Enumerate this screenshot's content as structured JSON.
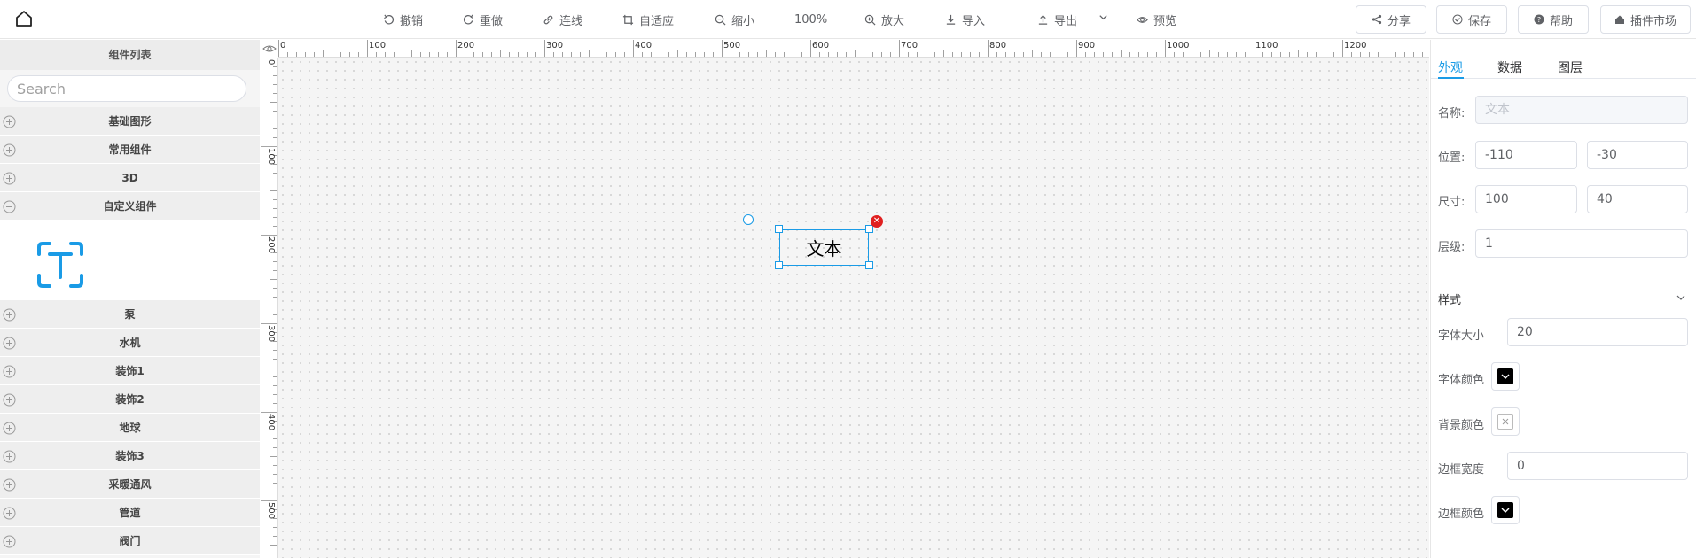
{
  "toolbar": {
    "undo": "撤销",
    "redo": "重做",
    "connect": "连线",
    "fit": "自适应",
    "zoom_out": "缩小",
    "zoom": "100%",
    "zoom_in": "放大",
    "import": "导入",
    "export": "导出",
    "preview": "预览",
    "share": "分享",
    "save": "保存",
    "help": "帮助",
    "plugin_market": "插件市场"
  },
  "left": {
    "title": "组件列表",
    "search_placeholder": "Search",
    "categories": [
      {
        "label": "基础图形",
        "expanded": false
      },
      {
        "label": "常用组件",
        "expanded": false
      },
      {
        "label": "3D",
        "expanded": false
      },
      {
        "label": "自定义组件",
        "expanded": true
      },
      {
        "label": "泵",
        "expanded": false
      },
      {
        "label": "水机",
        "expanded": false
      },
      {
        "label": "装饰1",
        "expanded": false
      },
      {
        "label": "装饰2",
        "expanded": false
      },
      {
        "label": "地球",
        "expanded": false
      },
      {
        "label": "装饰3",
        "expanded": false
      },
      {
        "label": "采暖通风",
        "expanded": false
      },
      {
        "label": "管道",
        "expanded": false
      },
      {
        "label": "阀门",
        "expanded": false
      }
    ]
  },
  "canvas": {
    "ruler_top": [
      "0",
      "100",
      "200",
      "300",
      "400",
      "500",
      "600",
      "700",
      "800",
      "900",
      "1000",
      "1100",
      "1200"
    ],
    "ruler_left": [
      "0",
      "100",
      "200",
      "300",
      "400",
      "500"
    ],
    "node_text": "文本"
  },
  "props": {
    "tabs": [
      "外观",
      "数据",
      "图层"
    ],
    "active_tab": "外观",
    "name_label": "名称:",
    "name_value": "文本",
    "pos_label": "位置:",
    "pos_x": "-110",
    "pos_y": "-30",
    "size_label": "尺寸:",
    "size_w": "100",
    "size_h": "40",
    "layer_label": "层级:",
    "layer_value": "1",
    "style_section": "样式",
    "font_size_label": "字体大小",
    "font_size_value": "20",
    "font_color_label": "字体颜色",
    "font_color": "#000000",
    "bg_color_label": "背景颜色",
    "border_width_label": "边框宽度",
    "border_width_value": "0",
    "border_color_label": "边框颜色",
    "border_color": "#000000"
  },
  "colors": {
    "accent": "#1a9be6",
    "delete": "#e02020",
    "panel_bg": "#f5f5f5"
  }
}
